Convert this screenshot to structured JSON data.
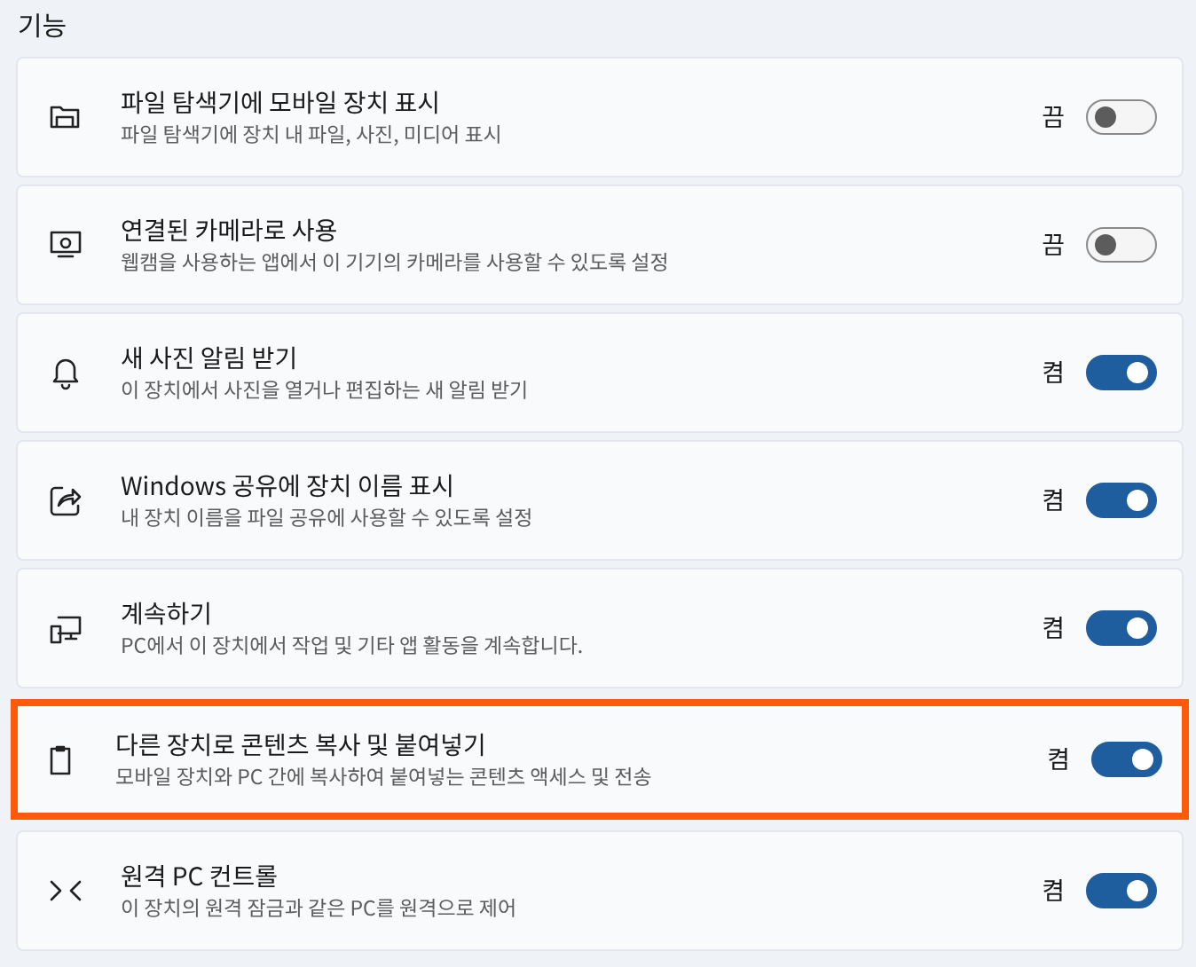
{
  "section_title": "기능",
  "settings": [
    {
      "title": "파일 탐색기에 모바일 장치 표시",
      "description": "파일 탐색기에 장치 내 파일, 사진, 미디어 표시",
      "state_label": "끔",
      "on": false,
      "highlighted": false
    },
    {
      "title": "연결된 카메라로 사용",
      "description": "웹캠을 사용하는 앱에서 이 기기의 카메라를 사용할 수 있도록 설정",
      "state_label": "끔",
      "on": false,
      "highlighted": false
    },
    {
      "title": "새 사진 알림 받기",
      "description": "이 장치에서 사진을 열거나 편집하는 새 알림 받기",
      "state_label": "켬",
      "on": true,
      "highlighted": false
    },
    {
      "title": "Windows 공유에 장치 이름 표시",
      "description": "내 장치 이름을 파일 공유에 사용할 수 있도록 설정",
      "state_label": "켬",
      "on": true,
      "highlighted": false
    },
    {
      "title": "계속하기",
      "description": "PC에서 이 장치에서 작업 및 기타 앱 활동을 계속합니다.",
      "state_label": "켬",
      "on": true,
      "highlighted": false
    },
    {
      "title": "다른 장치로 콘텐츠 복사 및 붙여넣기",
      "description": "모바일 장치와 PC 간에 복사하여 붙여넣는 콘텐츠 액세스 및 전송",
      "state_label": "켬",
      "on": true,
      "highlighted": true
    },
    {
      "title": "원격 PC 컨트롤",
      "description": "이 장치의 원격 잠금과 같은 PC를 원격으로 제어",
      "state_label": "켬",
      "on": true,
      "highlighted": false
    }
  ]
}
